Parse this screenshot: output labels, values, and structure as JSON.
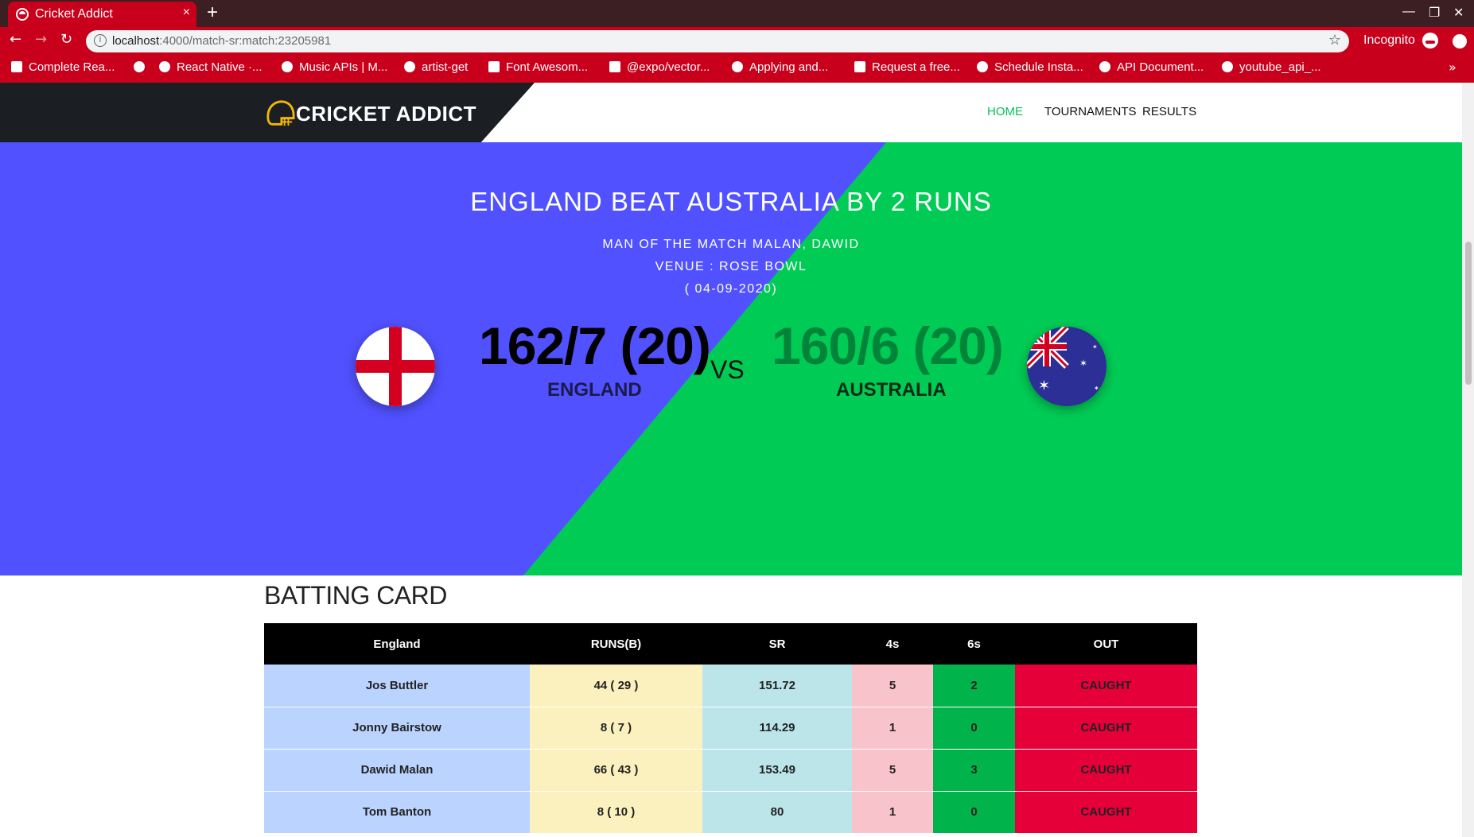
{
  "browser": {
    "tab_title": "Cricket Addict",
    "tab_close": "×",
    "new_tab": "+",
    "url_host": "localhost",
    "url_rest": ":4000/match-sr:match:23205981",
    "incognito_label": "Incognito",
    "bookmarks": [
      {
        "label": "Complete Rea..."
      },
      {
        "label": ""
      },
      {
        "label": "React Native ·..."
      },
      {
        "label": "Music APIs | M..."
      },
      {
        "label": "artist-get"
      },
      {
        "label": "Font Awesom..."
      },
      {
        "label": "@expo/vector..."
      },
      {
        "label": "Applying and..."
      },
      {
        "label": "Request a free..."
      },
      {
        "label": "Schedule Insta..."
      },
      {
        "label": "API Document..."
      },
      {
        "label": "youtube_api_..."
      }
    ],
    "bookmarks_more": "»"
  },
  "site": {
    "logo_text": "CRICKET ADDICT",
    "nav": [
      {
        "label": "HOME",
        "active": true
      },
      {
        "label": "TOURNAMENTS",
        "active": false
      },
      {
        "label": "RESULTS",
        "active": false
      }
    ]
  },
  "match": {
    "result": "ENGLAND BEAT AUSTRALIA BY 2 RUNS",
    "man_of_match": "MAN OF THE MATCH MALAN, DAWID",
    "venue": "VENUE : ROSE BOWL",
    "date": "( 04-09-2020)",
    "vs": "VS",
    "team1": {
      "name": "ENGLAND",
      "score": "162/7 (20)",
      "flag": "england-flag"
    },
    "team2": {
      "name": "AUSTRALIA",
      "score": "160/6 (20)",
      "flag": "australia-flag"
    },
    "colors": {
      "team1_bg": "#5151ff",
      "team2_bg": "#00cc55",
      "team2_score": "#00843a",
      "nav_active": "#00c257"
    }
  },
  "batting": {
    "title": "BATTING CARD",
    "headers": [
      "England",
      "RUNS(B)",
      "SR",
      "4s",
      "6s",
      "OUT"
    ],
    "rows": [
      {
        "name": "Jos Buttler",
        "runs": "44 ( 29 )",
        "sr": "151.72",
        "fours": "5",
        "sixes": "2",
        "out": "CAUGHT"
      },
      {
        "name": "Jonny Bairstow",
        "runs": "8 ( 7 )",
        "sr": "114.29",
        "fours": "1",
        "sixes": "0",
        "out": "CAUGHT"
      },
      {
        "name": "Dawid Malan",
        "runs": "66 ( 43 )",
        "sr": "153.49",
        "fours": "5",
        "sixes": "3",
        "out": "CAUGHT"
      },
      {
        "name": "Tom Banton",
        "runs": "8 ( 10 )",
        "sr": "80",
        "fours": "1",
        "sixes": "0",
        "out": "CAUGHT"
      }
    ]
  }
}
